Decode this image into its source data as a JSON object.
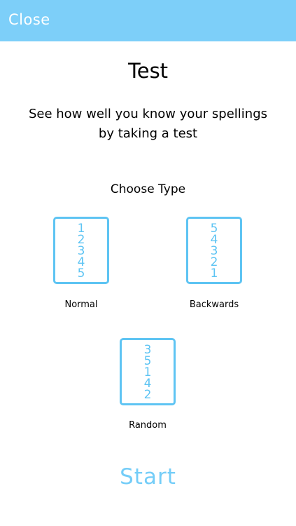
{
  "header": {
    "close_label": "Close"
  },
  "title": "Test",
  "subtitle_line1": "See how well you know your spellings",
  "subtitle_line2": "by taking a test",
  "choose_type_label": "Choose Type",
  "options": [
    {
      "label": "Normal",
      "digits": [
        "1",
        "2",
        "3",
        "4",
        "5"
      ]
    },
    {
      "label": "Backwards",
      "digits": [
        "5",
        "4",
        "3",
        "2",
        "1"
      ]
    },
    {
      "label": "Random",
      "digits": [
        "3",
        "5",
        "1",
        "4",
        "2"
      ]
    }
  ],
  "start_label": "Start",
  "colors": {
    "header_bar": "#7dcff9",
    "accent": "#5ec4f3",
    "start_text": "#74cdf8"
  }
}
